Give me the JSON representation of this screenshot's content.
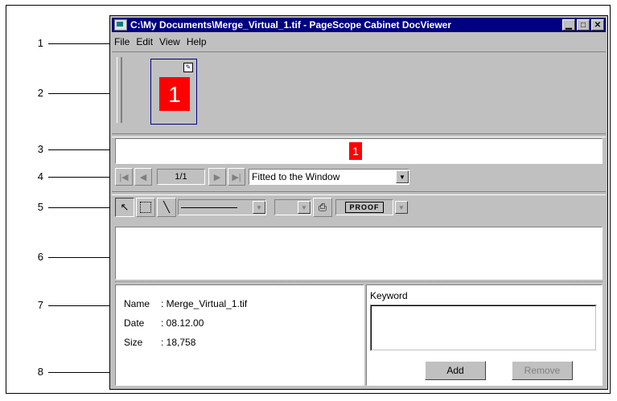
{
  "window": {
    "title": "C:\\My Documents\\Merge_Virtual_1.tif - PageScope Cabinet DocViewer",
    "controls": [
      "minimize",
      "maximize",
      "close"
    ]
  },
  "menu": {
    "items": [
      {
        "label": "File"
      },
      {
        "label": "Edit"
      },
      {
        "label": "View"
      },
      {
        "label": "Help"
      }
    ]
  },
  "thumbnails": {
    "page_label": "1"
  },
  "page_strip": {
    "marker": "1"
  },
  "navigation": {
    "page_indicator": "1/1",
    "zoom_value": "Fitted to the Window"
  },
  "annotation_toolbar": {
    "stamp_label": "PROOF"
  },
  "properties": {
    "name_key": "Name",
    "name_val": ": Merge_Virtual_1.tif",
    "date_key": "Date",
    "date_val": ": 08.12.00",
    "size_key": "Size",
    "size_val": ": 18,758"
  },
  "keywords": {
    "label": "Keyword",
    "add_label": "Add",
    "remove_label": "Remove"
  },
  "callouts": [
    "1",
    "2",
    "3",
    "4",
    "5",
    "6",
    "7",
    "8"
  ],
  "colors": {
    "titlebar": "#000080",
    "page_marker": "#ff0000",
    "window_bg": "#c0c0c0"
  }
}
